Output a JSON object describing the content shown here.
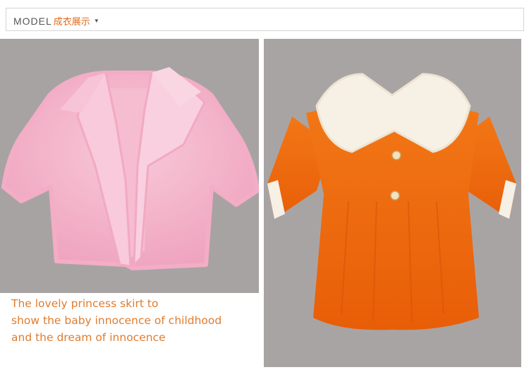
{
  "header": {
    "title_en": "MODEL",
    "title_cn": "成衣展示",
    "caret_icon": "caret-down-icon"
  },
  "caption": {
    "lines": [
      "The lovely princess skirt to",
      "show the baby innocence of childhood",
      "and the dream of innocence"
    ]
  },
  "colors": {
    "caption": "#e07c2e",
    "header_cn": "#e06a1a",
    "photo_bg": "#a8a3a3",
    "pink_garment": "#f4b8cc",
    "orange_garment": "#ef6a0c",
    "cream_collar": "#f7f0e4"
  }
}
